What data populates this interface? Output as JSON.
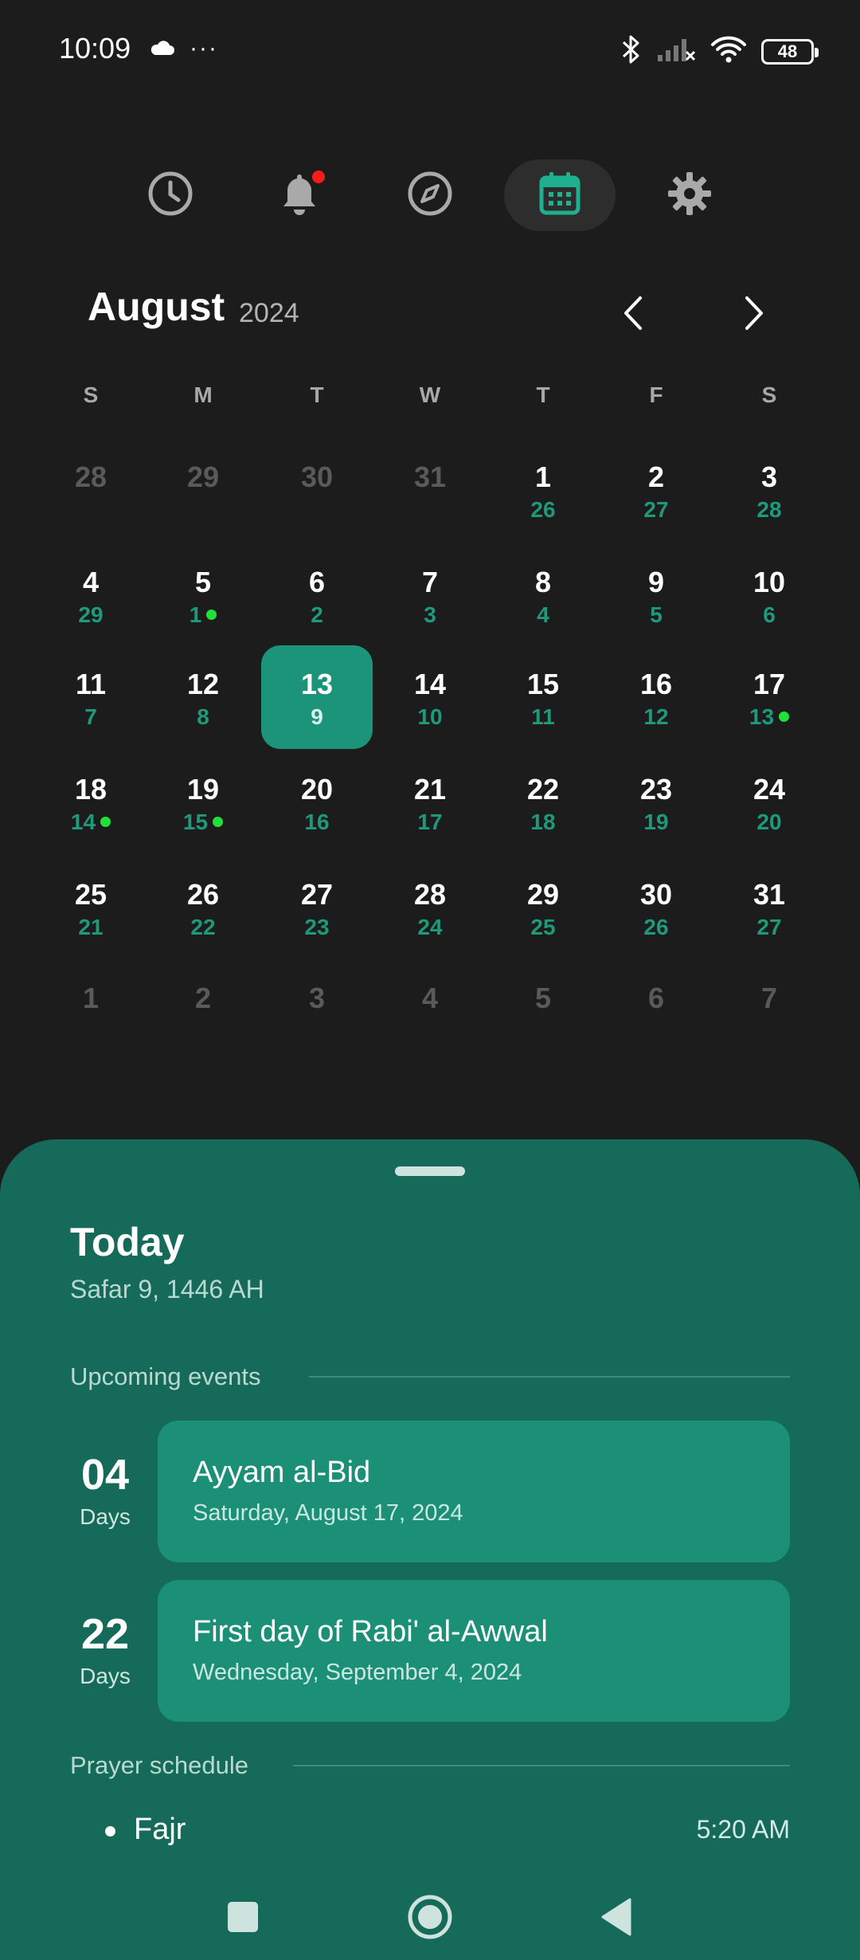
{
  "status_bar": {
    "time": "10:09",
    "overflow": "···",
    "battery": "48",
    "icons": [
      "cloud-icon",
      "bluetooth-icon",
      "signal-off-icon",
      "wifi-icon",
      "battery-icon"
    ]
  },
  "top_nav": {
    "items": [
      {
        "name": "clock-icon",
        "active": false
      },
      {
        "name": "bell-icon",
        "active": false,
        "badge": true
      },
      {
        "name": "compass-icon",
        "active": false
      },
      {
        "name": "calendar-icon",
        "active": true
      },
      {
        "name": "gear-icon",
        "active": false
      }
    ]
  },
  "calendar": {
    "month": "August",
    "year": "2024",
    "weekdays": [
      "S",
      "M",
      "T",
      "W",
      "T",
      "F",
      "S"
    ],
    "weeks": [
      [
        {
          "g": "28",
          "h": "",
          "other": true
        },
        {
          "g": "29",
          "h": "",
          "other": true
        },
        {
          "g": "30",
          "h": "",
          "other": true
        },
        {
          "g": "31",
          "h": "",
          "other": true
        },
        {
          "g": "1",
          "h": "26"
        },
        {
          "g": "2",
          "h": "27"
        },
        {
          "g": "3",
          "h": "28"
        }
      ],
      [
        {
          "g": "4",
          "h": "29"
        },
        {
          "g": "5",
          "h": "1",
          "event": true
        },
        {
          "g": "6",
          "h": "2"
        },
        {
          "g": "7",
          "h": "3"
        },
        {
          "g": "8",
          "h": "4"
        },
        {
          "g": "9",
          "h": "5"
        },
        {
          "g": "10",
          "h": "6"
        }
      ],
      [
        {
          "g": "11",
          "h": "7"
        },
        {
          "g": "12",
          "h": "8"
        },
        {
          "g": "13",
          "h": "9",
          "today": true
        },
        {
          "g": "14",
          "h": "10"
        },
        {
          "g": "15",
          "h": "11"
        },
        {
          "g": "16",
          "h": "12"
        },
        {
          "g": "17",
          "h": "13",
          "event": true
        }
      ],
      [
        {
          "g": "18",
          "h": "14",
          "event": true
        },
        {
          "g": "19",
          "h": "15",
          "event": true
        },
        {
          "g": "20",
          "h": "16"
        },
        {
          "g": "21",
          "h": "17"
        },
        {
          "g": "22",
          "h": "18"
        },
        {
          "g": "23",
          "h": "19"
        },
        {
          "g": "24",
          "h": "20"
        }
      ],
      [
        {
          "g": "25",
          "h": "21"
        },
        {
          "g": "26",
          "h": "22"
        },
        {
          "g": "27",
          "h": "23"
        },
        {
          "g": "28",
          "h": "24"
        },
        {
          "g": "29",
          "h": "25"
        },
        {
          "g": "30",
          "h": "26"
        },
        {
          "g": "31",
          "h": "27"
        }
      ],
      [
        {
          "g": "1",
          "h": "",
          "other": true
        },
        {
          "g": "2",
          "h": "",
          "other": true
        },
        {
          "g": "3",
          "h": "",
          "other": true
        },
        {
          "g": "4",
          "h": "",
          "other": true
        },
        {
          "g": "5",
          "h": "",
          "other": true
        },
        {
          "g": "6",
          "h": "",
          "other": true
        },
        {
          "g": "7",
          "h": "",
          "other": true
        }
      ]
    ]
  },
  "today": {
    "title": "Today",
    "hijri_date": "Safar 9, 1446 AH"
  },
  "upcoming": {
    "label": "Upcoming events",
    "events": [
      {
        "days": "04",
        "unit": "Days",
        "title": "Ayyam al-Bid",
        "date": "Saturday, August 17, 2024"
      },
      {
        "days": "22",
        "unit": "Days",
        "title": "First day of Rabi' al-Awwal",
        "date": "Wednesday, September 4, 2024"
      }
    ]
  },
  "prayer": {
    "label": "Prayer schedule",
    "items": [
      {
        "name": "Fajr",
        "time": "5:20 AM"
      }
    ]
  },
  "colors": {
    "background": "#1c1c1c",
    "accent": "#1b9479",
    "sheet": "#156a5a",
    "hijri_text": "#1e9a7a",
    "event_dot": "#22e03a",
    "badge": "#ff1a1a"
  }
}
